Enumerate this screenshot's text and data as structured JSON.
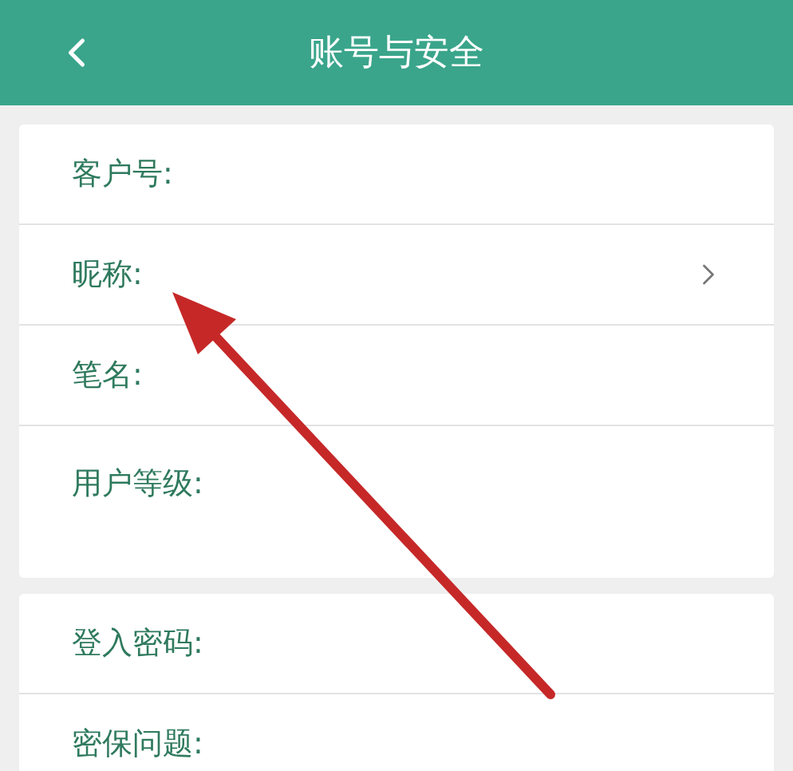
{
  "header": {
    "title": "账号与安全"
  },
  "sections": [
    {
      "rows": [
        {
          "label": "客户号:",
          "kind": "plain"
        },
        {
          "label": "昵称:",
          "kind": "link"
        },
        {
          "label": "笔名:",
          "kind": "plain"
        },
        {
          "label": "用户等级:",
          "kind": "tall"
        }
      ]
    },
    {
      "rows": [
        {
          "label": "登入密码:",
          "kind": "plain"
        },
        {
          "label": "密保问题:",
          "kind": "plain"
        }
      ]
    }
  ]
}
